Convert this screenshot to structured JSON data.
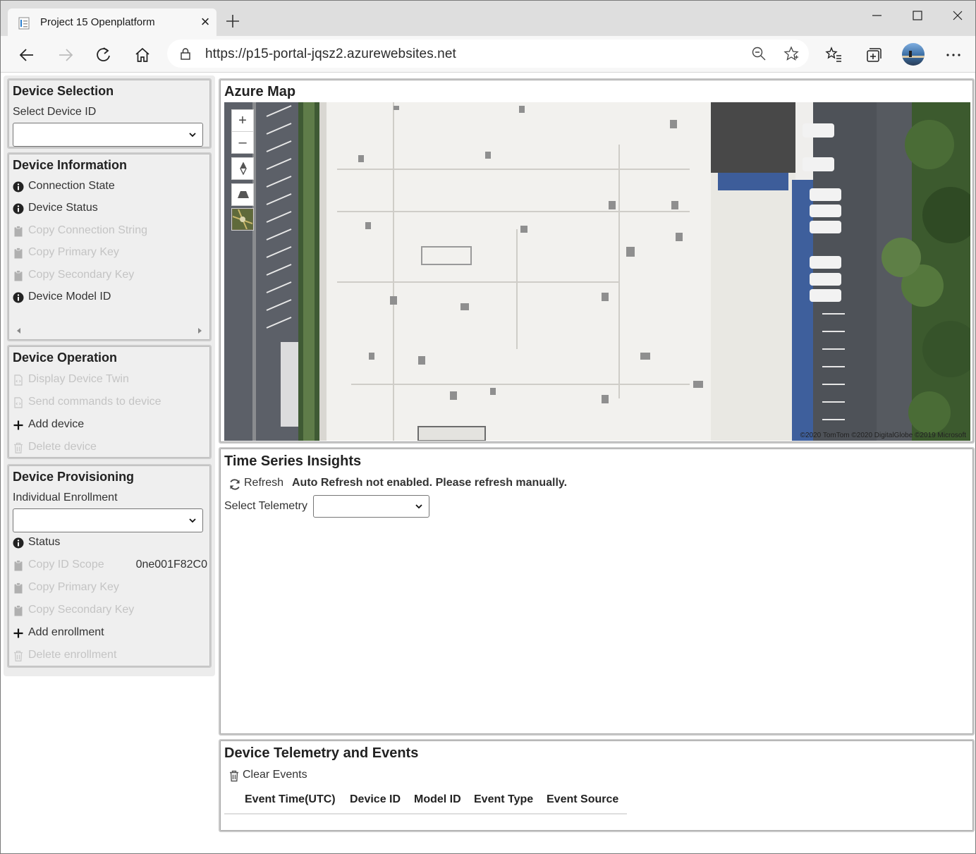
{
  "browser": {
    "tab_title": "Project 15 Openplatform",
    "url": "https://p15-portal-jqsz2.azurewebsites.net"
  },
  "device_selection": {
    "title": "Device Selection",
    "label": "Select Device ID",
    "selected": ""
  },
  "device_information": {
    "title": "Device Information",
    "items": [
      {
        "label": "Connection State",
        "icon": "info-icon",
        "enabled": true
      },
      {
        "label": "Device Status",
        "icon": "info-icon",
        "enabled": true
      },
      {
        "label": "Copy Connection String",
        "icon": "clipboard-icon",
        "enabled": false
      },
      {
        "label": "Copy Primary Key",
        "icon": "clipboard-icon",
        "enabled": false
      },
      {
        "label": "Copy Secondary Key",
        "icon": "clipboard-icon",
        "enabled": false
      },
      {
        "label": "Device Model ID",
        "icon": "info-icon",
        "enabled": true
      }
    ]
  },
  "device_operation": {
    "title": "Device Operation",
    "items": [
      {
        "label": "Display Device Twin",
        "icon": "code-file-icon",
        "enabled": false
      },
      {
        "label": "Send commands to device",
        "icon": "code-file-icon",
        "enabled": false
      },
      {
        "label": "Add device",
        "icon": "plus-icon",
        "enabled": true
      },
      {
        "label": "Delete device",
        "icon": "trash-icon",
        "enabled": false
      }
    ]
  },
  "device_provisioning": {
    "title": "Device Provisioning",
    "label": "Individual Enrollment",
    "selected": "",
    "items": [
      {
        "label": "Status",
        "icon": "info-icon",
        "enabled": true
      },
      {
        "label": "Copy ID Scope",
        "icon": "clipboard-icon",
        "enabled": false,
        "value": "0ne001F82C0"
      },
      {
        "label": "Copy Primary Key",
        "icon": "clipboard-icon",
        "enabled": false
      },
      {
        "label": "Copy Secondary Key",
        "icon": "clipboard-icon",
        "enabled": false
      },
      {
        "label": "Add enrollment",
        "icon": "plus-icon",
        "enabled": true
      },
      {
        "label": "Delete enrollment",
        "icon": "trash-icon",
        "enabled": false
      }
    ]
  },
  "azure_map": {
    "title": "Azure Map",
    "zoom_in": "+",
    "zoom_out": "–",
    "copyright": "©2020 TomTom ©2020 DigitalGlobe ©2019 Microsoft"
  },
  "time_series": {
    "title": "Time Series Insights",
    "refresh_label": "Refresh",
    "message": "Auto Refresh not enabled. Please refresh manually.",
    "telemetry_label": "Select Telemetry",
    "telemetry_selected": ""
  },
  "telemetry_events": {
    "title": "Device Telemetry and Events",
    "clear_label": "Clear Events",
    "columns": [
      "Event Time(UTC)",
      "Device ID",
      "Model ID",
      "Event Type",
      "Event Source"
    ]
  },
  "colors": {
    "disabled_text": "#c4c4c4",
    "panel_bg": "#efefef"
  }
}
